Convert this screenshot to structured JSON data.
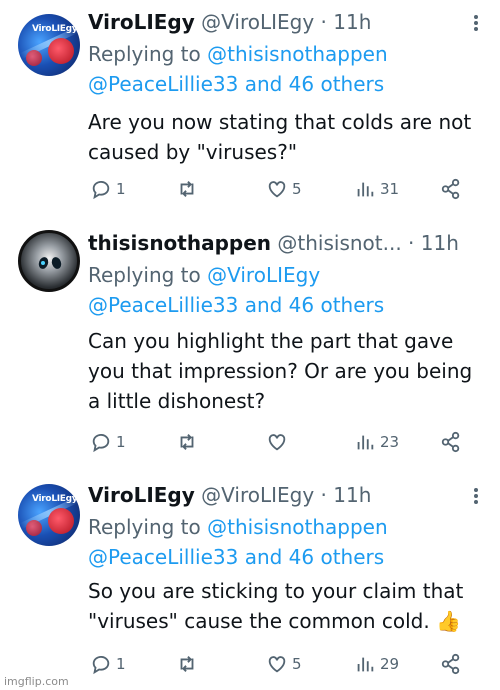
{
  "tweets": [
    {
      "avatar": "virolie-avatar",
      "avatar_text": "ViroLIEgy",
      "name": "ViroLIEgy",
      "handle": "@ViroLIEgy",
      "sep": "·",
      "time": "11h",
      "replying_prefix": "Replying to",
      "replying_line1": "@thisisnothappen",
      "replying_line2": "@PeaceLillie33 and 46 others",
      "body_line1": "Are you now stating that colds are not",
      "body_line2": "caused by \"viruses?\"",
      "replies": "1",
      "retweets": "",
      "likes": "5",
      "views": "31"
    },
    {
      "avatar": "alien-avatar",
      "name": "thisisnothappen",
      "handle": "@thisisnot...",
      "sep": "·",
      "time": "11h",
      "replying_prefix": "Replying to",
      "replying_line1": "@ViroLIEgy",
      "replying_line2": "@PeaceLillie33 and 46 others",
      "body_line1": "Can you highlight the part that gave",
      "body_line2": "you that impression? Or are you being",
      "body_line3": "a little dishonest?",
      "replies": "1",
      "retweets": "",
      "likes": "",
      "views": "23"
    },
    {
      "avatar": "virolie-avatar",
      "avatar_text": "ViroLIEgy",
      "name": "ViroLIEgy",
      "handle": "@ViroLIEgy",
      "sep": "·",
      "time": "11h",
      "replying_prefix": "Replying to",
      "replying_line1": "@thisisnothappen",
      "replying_line2": "@PeaceLillie33 and 46 others",
      "body_line1": "So you are sticking to your claim that",
      "body_line2": "\"viruses\" cause the common cold.",
      "body_emoji": "👍",
      "replies": "1",
      "retweets": "",
      "likes": "5",
      "views": "29"
    }
  ],
  "watermark": "imgflip.com",
  "colors": {
    "link": "#1d9bf0",
    "muted": "#536471",
    "text": "#0f1419"
  }
}
